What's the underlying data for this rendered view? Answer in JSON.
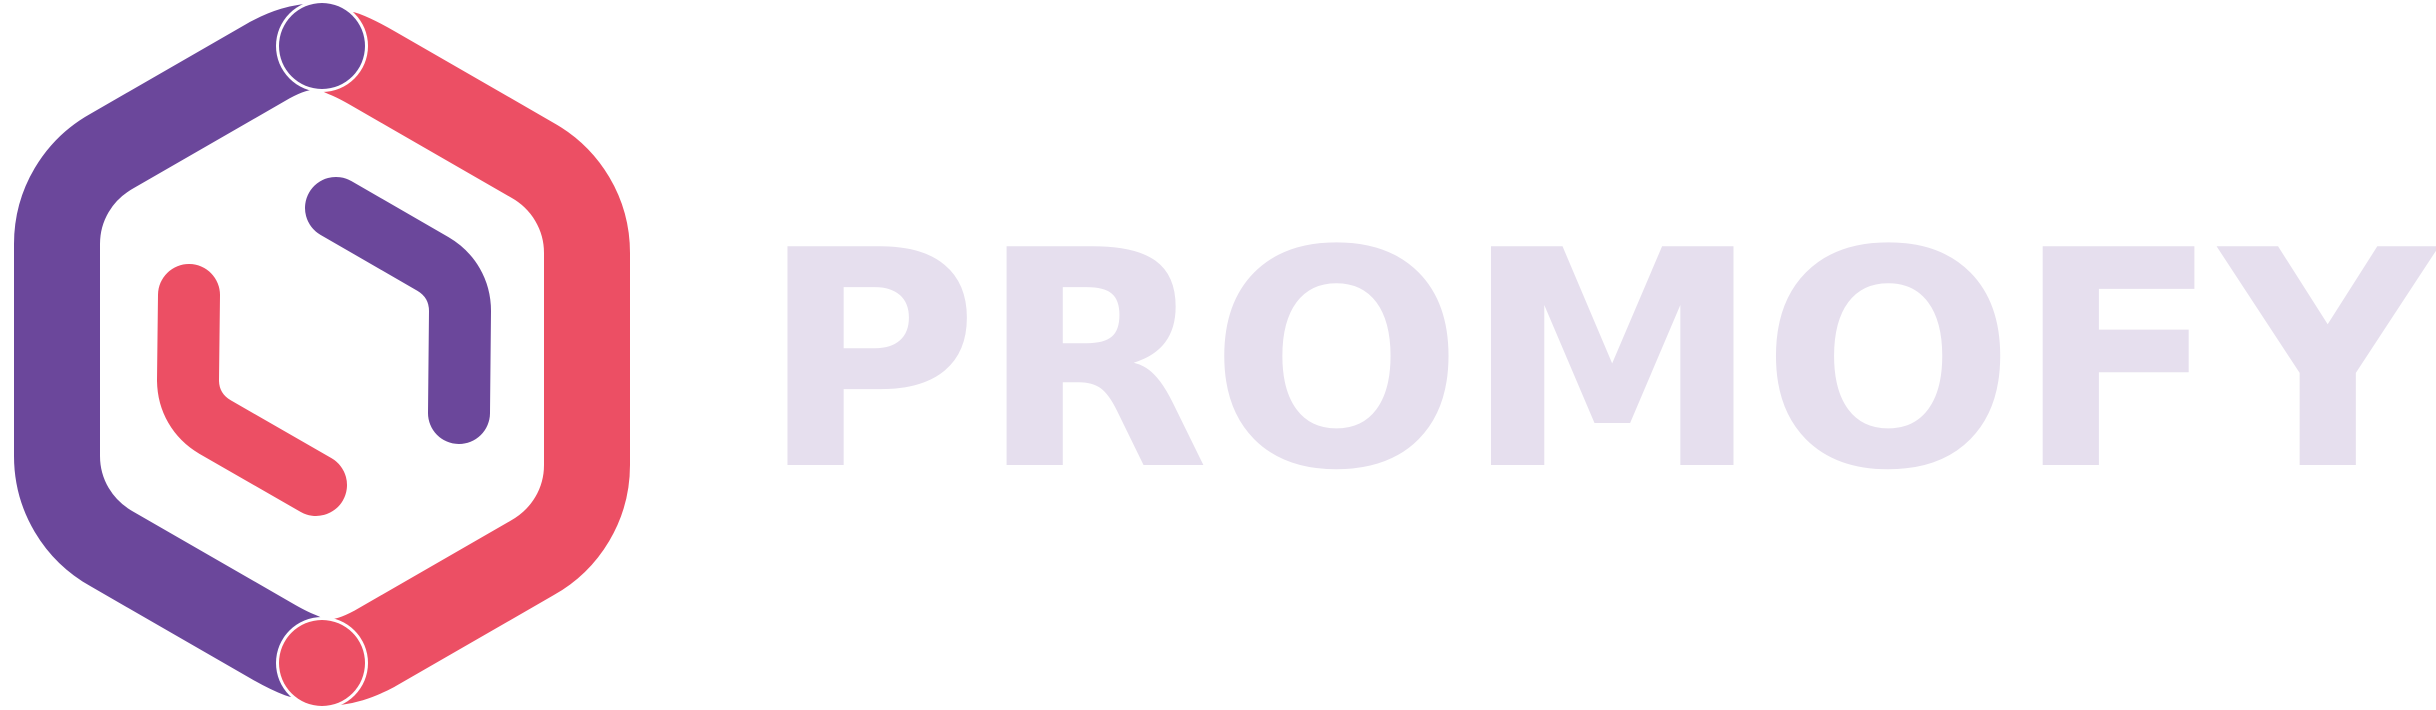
{
  "brand": {
    "name": "PROMOFY",
    "colors": {
      "purple": "#6B479B",
      "red": "#EC4F64",
      "wordmark": "#E6DFEE"
    }
  }
}
